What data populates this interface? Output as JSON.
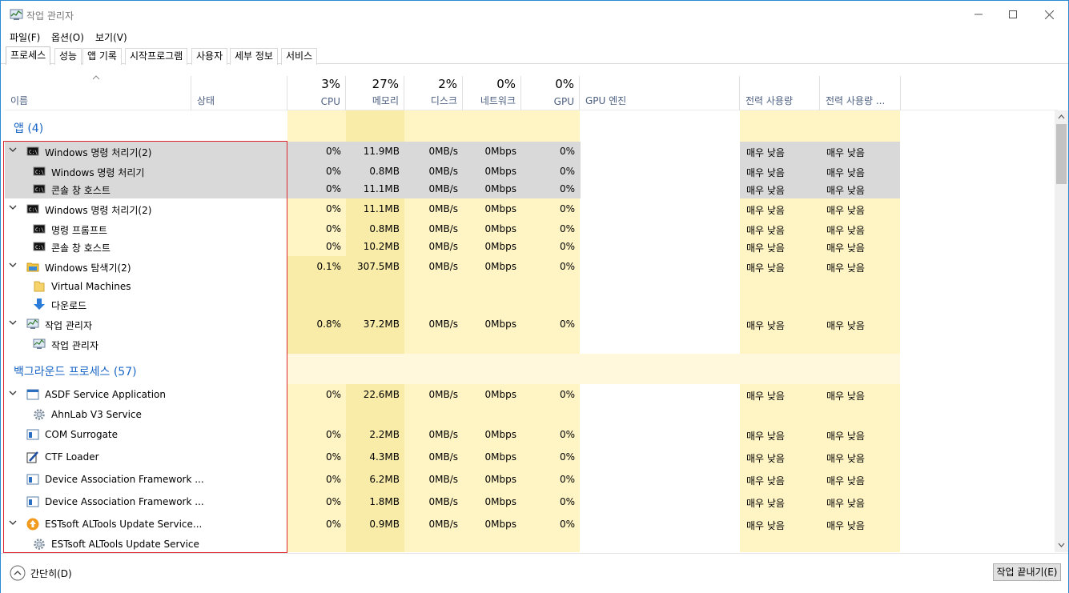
{
  "window": {
    "title": "작업 관리자"
  },
  "menu": [
    "파일(F)",
    "옵션(O)",
    "보기(V)"
  ],
  "tabs": [
    "프로세스",
    "성능",
    "앱 기록",
    "시작프로그램",
    "사용자",
    "세부 정보",
    "서비스"
  ],
  "columns": {
    "name": "이름",
    "status": "상태",
    "cpu": {
      "pct": "3%",
      "label": "CPU"
    },
    "memory": {
      "pct": "27%",
      "label": "메모리"
    },
    "disk": {
      "pct": "2%",
      "label": "디스크"
    },
    "network": {
      "pct": "0%",
      "label": "네트워크"
    },
    "gpu": {
      "pct": "0%",
      "label": "GPU"
    },
    "gpu_engine": "GPU 엔진",
    "power": "전력 사용량",
    "power_trend": "전력 사용량 ..."
  },
  "groups": {
    "apps": "앱 (4)",
    "background": "백그라운드 프로세스 (57)"
  },
  "rows": [
    {
      "name": "Windows 명령 처리기(2)",
      "cpu": "0%",
      "mem": "11.9MB",
      "disk": "0MB/s",
      "net": "0Mbps",
      "gpu": "0%",
      "p1": "매우 낮음",
      "p2": "매우 낮음"
    },
    {
      "name": "Windows 명령 처리기",
      "cpu": "0%",
      "mem": "0.8MB",
      "disk": "0MB/s",
      "net": "0Mbps",
      "gpu": "0%",
      "p1": "매우 낮음",
      "p2": "매우 낮음"
    },
    {
      "name": "콘솔 창 호스트",
      "cpu": "0%",
      "mem": "11.1MB",
      "disk": "0MB/s",
      "net": "0Mbps",
      "gpu": "0%",
      "p1": "매우 낮음",
      "p2": "매우 낮음"
    },
    {
      "name": "Windows 명령 처리기(2)",
      "cpu": "0%",
      "mem": "11.1MB",
      "disk": "0MB/s",
      "net": "0Mbps",
      "gpu": "0%",
      "p1": "매우 낮음",
      "p2": "매우 낮음"
    },
    {
      "name": "명령 프롬프트",
      "cpu": "0%",
      "mem": "0.8MB",
      "disk": "0MB/s",
      "net": "0Mbps",
      "gpu": "0%",
      "p1": "매우 낮음",
      "p2": "매우 낮음"
    },
    {
      "name": "콘솔 창 호스트",
      "cpu": "0%",
      "mem": "10.2MB",
      "disk": "0MB/s",
      "net": "0Mbps",
      "gpu": "0%",
      "p1": "매우 낮음",
      "p2": "매우 낮음"
    },
    {
      "name": "Windows 탐색기(2)",
      "cpu": "0.1%",
      "mem": "307.5MB",
      "disk": "0MB/s",
      "net": "0Mbps",
      "gpu": "0%",
      "p1": "매우 낮음",
      "p2": "매우 낮음"
    },
    {
      "name": "Virtual Machines"
    },
    {
      "name": "다운로드"
    },
    {
      "name": "작업 관리자",
      "cpu": "0.8%",
      "mem": "37.2MB",
      "disk": "0MB/s",
      "net": "0Mbps",
      "gpu": "0%",
      "p1": "매우 낮음",
      "p2": "매우 낮음"
    },
    {
      "name": "작업 관리자"
    },
    {
      "name": "ASDF Service Application",
      "cpu": "0%",
      "mem": "22.6MB",
      "disk": "0MB/s",
      "net": "0Mbps",
      "gpu": "0%",
      "p1": "매우 낮음",
      "p2": "매우 낮음"
    },
    {
      "name": "AhnLab V3 Service"
    },
    {
      "name": "COM Surrogate",
      "cpu": "0%",
      "mem": "2.2MB",
      "disk": "0MB/s",
      "net": "0Mbps",
      "gpu": "0%",
      "p1": "매우 낮음",
      "p2": "매우 낮음"
    },
    {
      "name": "CTF Loader",
      "cpu": "0%",
      "mem": "4.3MB",
      "disk": "0MB/s",
      "net": "0Mbps",
      "gpu": "0%",
      "p1": "매우 낮음",
      "p2": "매우 낮음"
    },
    {
      "name": "Device Association Framework ...",
      "cpu": "0%",
      "mem": "6.2MB",
      "disk": "0MB/s",
      "net": "0Mbps",
      "gpu": "0%",
      "p1": "매우 낮음",
      "p2": "매우 낮음"
    },
    {
      "name": "Device Association Framework ...",
      "cpu": "0%",
      "mem": "1.8MB",
      "disk": "0MB/s",
      "net": "0Mbps",
      "gpu": "0%",
      "p1": "매우 낮음",
      "p2": "매우 낮음"
    },
    {
      "name": "ESTsoft ALTools Update Service...",
      "cpu": "0%",
      "mem": "0.9MB",
      "disk": "0MB/s",
      "net": "0Mbps",
      "gpu": "0%",
      "p1": "매우 낮음",
      "p2": "매우 낮음"
    },
    {
      "name": "ESTsoft ALTools Update Service"
    }
  ],
  "footer": {
    "collapse": "간단히(D)",
    "end_task": "작업 끝내기(E)"
  }
}
